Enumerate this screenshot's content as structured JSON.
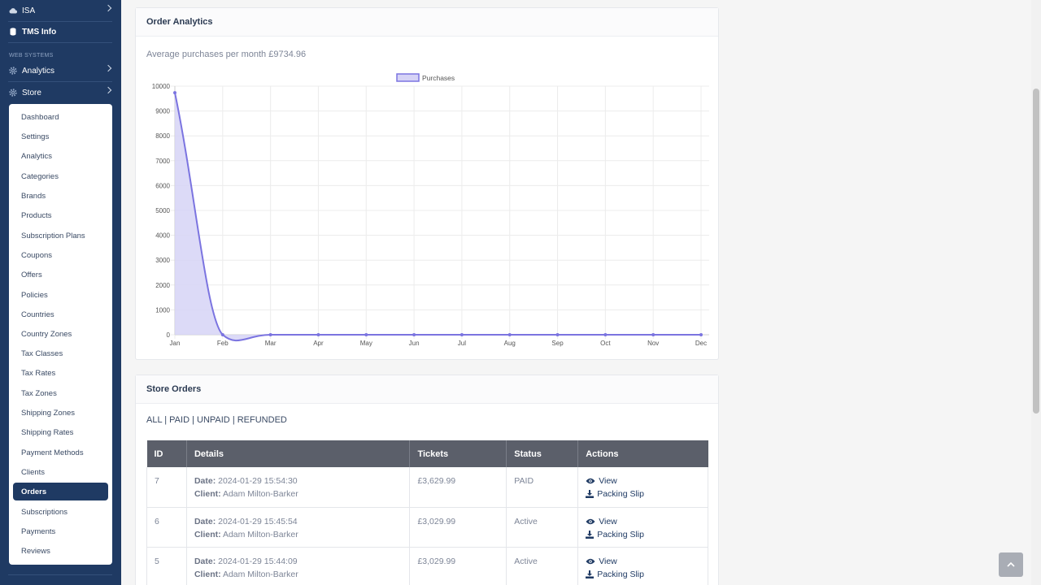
{
  "sidebar": {
    "top_items": [
      {
        "label": "ISA",
        "icon": "cloud-icon"
      },
      {
        "label": "TMS Info",
        "icon": "database-icon"
      }
    ],
    "section_heading": "WEB SYSTEMS",
    "section_items": [
      {
        "label": "Analytics",
        "icon": "gear-icon"
      },
      {
        "label": "Store",
        "icon": "gear-icon"
      }
    ],
    "store_submenu": [
      "Dashboard",
      "Settings",
      "Analytics",
      "Categories",
      "Brands",
      "Products",
      "Subscription Plans",
      "Coupons",
      "Offers",
      "Policies",
      "Countries",
      "Country Zones",
      "Tax Classes",
      "Tax Rates",
      "Tax Zones",
      "Shipping Zones",
      "Shipping Rates",
      "Payment Methods",
      "Clients",
      "Orders",
      "Subscriptions",
      "Payments",
      "Reviews"
    ],
    "active_item": "Orders"
  },
  "analytics": {
    "title": "Order Analytics",
    "avg_text": "Average purchases per month £9734.96"
  },
  "chart_data": {
    "type": "area",
    "categories": [
      "Jan",
      "Feb",
      "Mar",
      "Apr",
      "May",
      "Jun",
      "Jul",
      "Aug",
      "Sep",
      "Oct",
      "Nov",
      "Dec"
    ],
    "series": [
      {
        "name": "Purchases",
        "values": [
          9734.96,
          0,
          0,
          0,
          0,
          0,
          0,
          0,
          0,
          0,
          0,
          0
        ]
      }
    ],
    "ylim": [
      0,
      10000
    ],
    "yticks": [
      0,
      1000,
      2000,
      3000,
      4000,
      5000,
      6000,
      7000,
      8000,
      9000,
      10000
    ],
    "grid": true,
    "legend": "top-center",
    "colors": {
      "line": "#7b74e0",
      "fill": "#d6d3f6"
    }
  },
  "orders": {
    "title": "Store Orders",
    "filters": [
      "ALL",
      "PAID",
      "UNPAID",
      "REFUNDED"
    ],
    "columns": [
      "ID",
      "Details",
      "Tickets",
      "Status",
      "Actions"
    ],
    "date_label": "Date:",
    "client_label": "Client:",
    "view_label": "View",
    "slip_label": "Packing Slip",
    "rows": [
      {
        "id": "7",
        "date": "2024-01-29 15:54:30",
        "client": "Adam Milton-Barker",
        "tickets": "£3,629.99",
        "status": "PAID"
      },
      {
        "id": "6",
        "date": "2024-01-29 15:45:54",
        "client": "Adam Milton-Barker",
        "tickets": "£3,029.99",
        "status": "Active"
      },
      {
        "id": "5",
        "date": "2024-01-29 15:44:09",
        "client": "Adam Milton-Barker",
        "tickets": "£3,029.99",
        "status": "Active"
      }
    ]
  }
}
